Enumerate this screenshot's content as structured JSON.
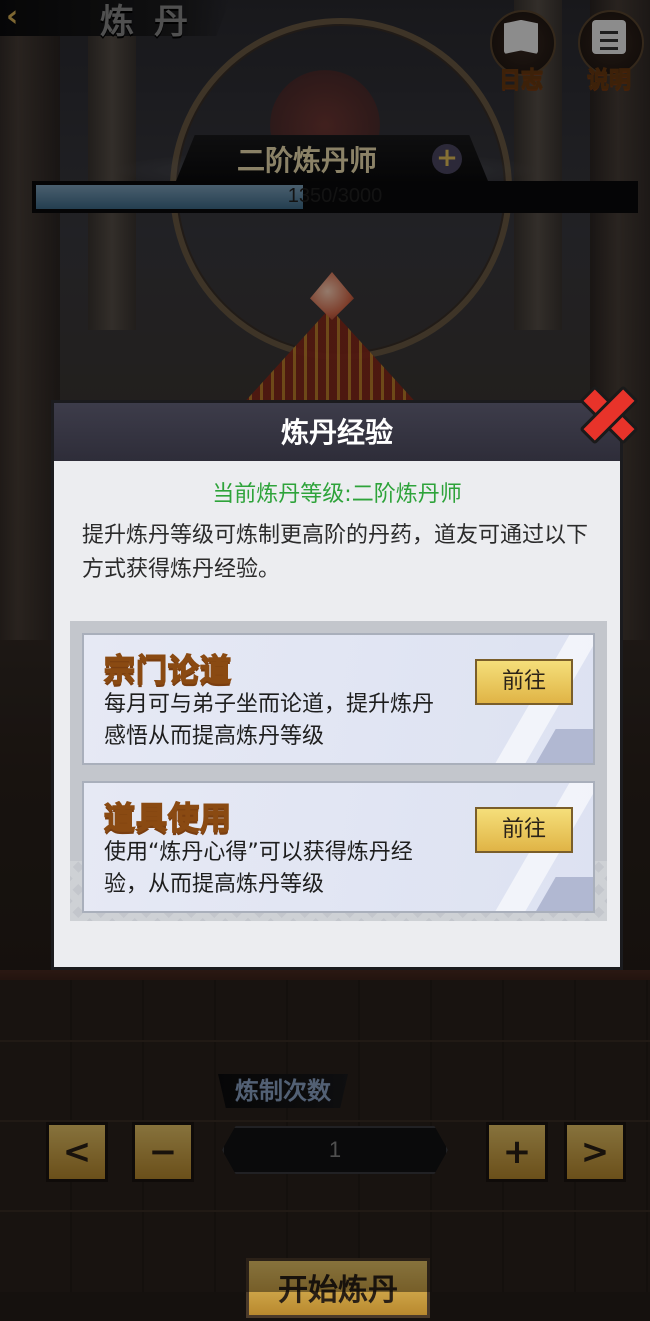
{
  "header": {
    "back_icon": "chevron-left-icon",
    "title": "炼丹",
    "log_label": "日志",
    "log_icon": "book-icon",
    "help_label": "说明",
    "help_icon": "note-icon"
  },
  "level": {
    "name": "二阶炼丹师",
    "plus": "+",
    "xp_current": 1350,
    "xp_max": 3000,
    "xp_text": "1350/3000",
    "progress": 0.45
  },
  "dialog": {
    "title": "炼丹经验",
    "current_level": "当前炼丹等级:二阶炼丹师",
    "description": "提升炼丹等级可炼制更高阶的丹药，道友可通过以下方式获得炼丹经验。",
    "close_icon": "close-x-icon",
    "options": [
      {
        "title": "宗门论道",
        "description": "每月可与弟子坐而论道，提升炼丹感悟从而提高炼丹等级",
        "button": "前往"
      },
      {
        "title": "道具使用",
        "description": "使用“炼丹心得”可以获得炼丹经验，从而提高炼丹等级",
        "button": "前往"
      }
    ]
  },
  "controls": {
    "count_label": "炼制次数",
    "prev_icon": "chevron-left",
    "minus": "−",
    "count_value": "1",
    "plus": "+",
    "next_icon": "chevron-right",
    "start_label": "开始炼丹"
  },
  "colors": {
    "accent_gold": "#e0b446",
    "level_green": "#2ea33a",
    "close_red": "#e8332a",
    "xp_blue": "#5f8aa8"
  }
}
